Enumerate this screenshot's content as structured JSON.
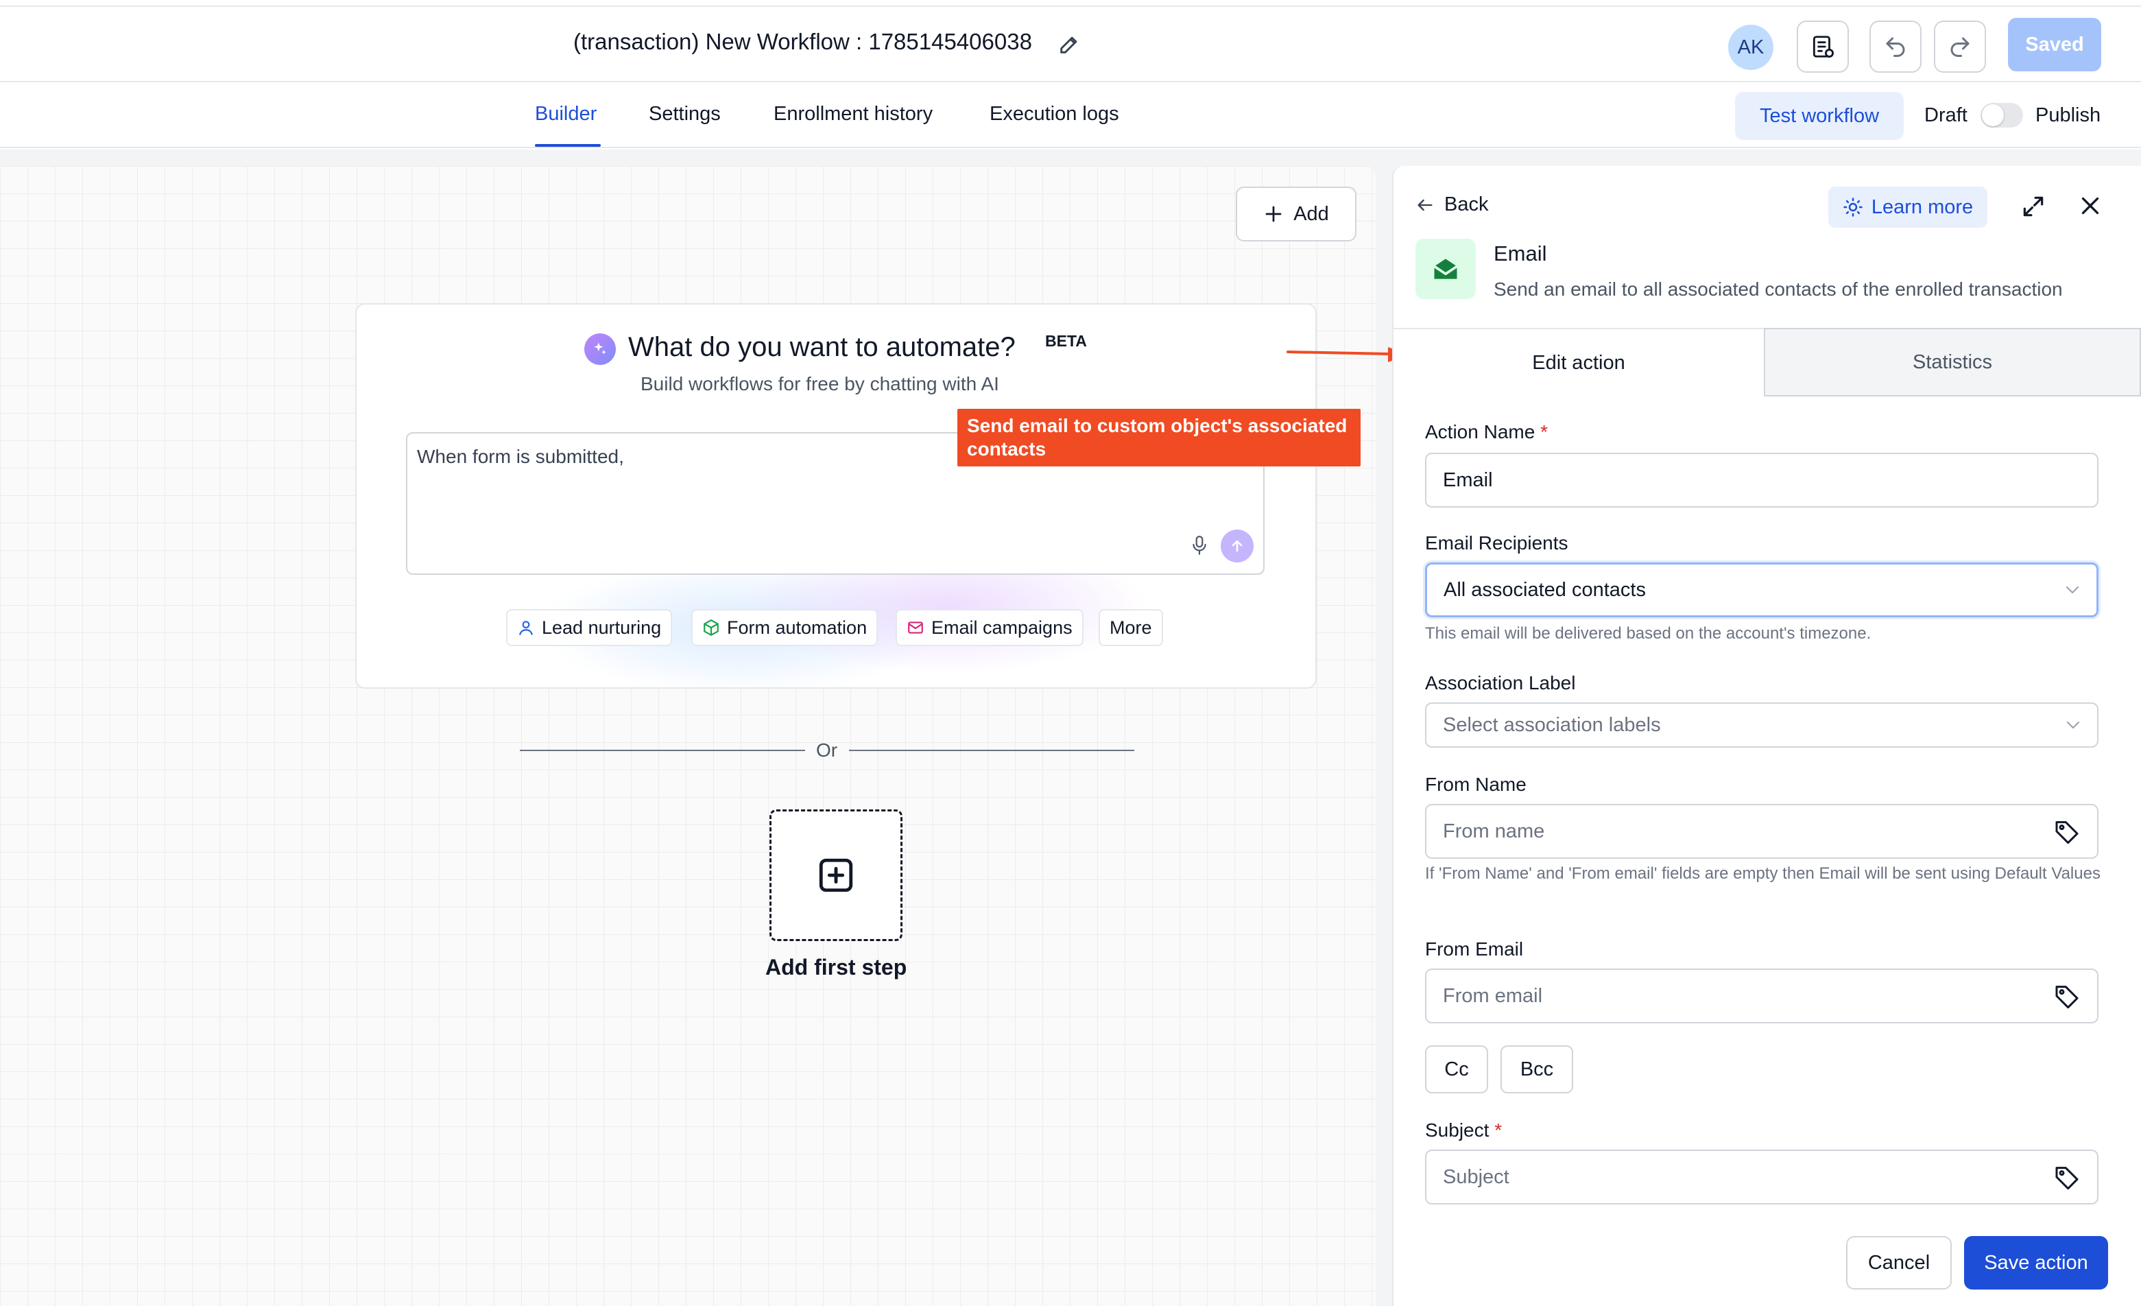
{
  "header": {
    "workflow_title": "(transaction) New Workflow : 1785145406038",
    "avatar_initials": "AK",
    "saved_label": "Saved"
  },
  "tabs": {
    "items": [
      {
        "label": "Builder",
        "active": true
      },
      {
        "label": "Settings"
      },
      {
        "label": "Enrollment history"
      },
      {
        "label": "Execution logs"
      }
    ],
    "test_workflow_label": "Test workflow",
    "draft_label": "Draft",
    "publish_label": "Publish",
    "publish_toggle_on": false
  },
  "canvas": {
    "add_label": "Add",
    "ai": {
      "title": "What do you want to automate?",
      "badge": "BETA",
      "subtitle": "Build workflows for free by chatting with AI",
      "input_text": "When form is submitted,",
      "chips": [
        "Lead nurturing",
        "Form automation",
        "Email campaigns",
        "More"
      ]
    },
    "or_label": "Or",
    "add_first_step_label": "Add first step"
  },
  "annotation": {
    "callout_text": "Send email to custom object's associated contacts",
    "color": "#f04b23"
  },
  "panel": {
    "back_label": "Back",
    "learn_more_label": "Learn more",
    "action_title": "Email",
    "action_description": "Send an email to all associated contacts of the enrolled transaction",
    "tabs": [
      "Edit action",
      "Statistics"
    ],
    "fields": {
      "action_name": {
        "label": "Action Name",
        "required": true,
        "value": "Email"
      },
      "email_recipients": {
        "label": "Email Recipients",
        "value": "All associated contacts",
        "hint": "This email will be delivered based on the account's timezone."
      },
      "association_label": {
        "label": "Association Label",
        "placeholder": "Select association labels"
      },
      "from_name": {
        "label": "From Name",
        "placeholder": "From name",
        "hint": "If 'From Name' and 'From email' fields are empty then Email will be sent using Default Values"
      },
      "from_email": {
        "label": "From Email",
        "placeholder": "From email"
      },
      "cc_label": "Cc",
      "bcc_label": "Bcc",
      "subject": {
        "label": "Subject",
        "required": true,
        "placeholder": "Subject"
      }
    },
    "cancel_label": "Cancel",
    "save_label": "Save action"
  },
  "colors": {
    "primary": "#1d4ed8",
    "saved_button": "#a5c3fb",
    "required": "#dc2626",
    "email_badge_bg": "#dcfce7",
    "email_badge_icon": "#15803d"
  }
}
